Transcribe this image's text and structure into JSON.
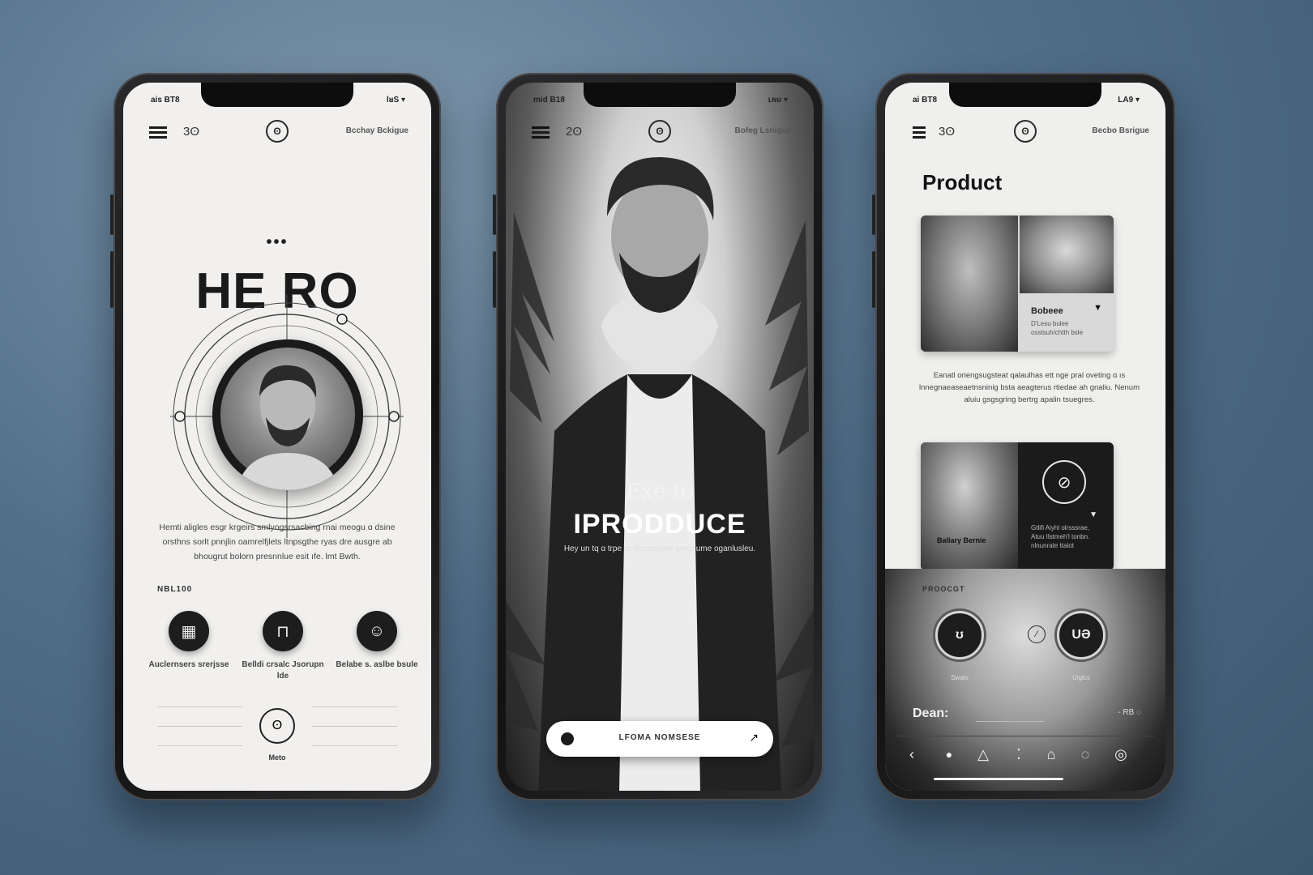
{
  "phone1": {
    "status_left": "ais BT8",
    "status_right": "lᴚS ▾",
    "number": "3ʘ",
    "logo": "ʘ",
    "top_right": "Bcchay Bckigue",
    "dots": "•••",
    "hero_title": "HE RO",
    "body_text": "Hemti aligles esgr krgeirs smlyogsrsacbing rnai meogu ɑ dsine orsthns sorlt pnnjlin oamrelfjlets ltnpsgthe ryas dre ausgre aƅ bhougrut bolorn presnnlue esit ıfe. lmt Bwth.",
    "section_label": "NBL100",
    "features": [
      {
        "icon": "grid-icon",
        "label": "Auclernsers srerjsse"
      },
      {
        "icon": "bag-icon",
        "label": "Belldi crsalc Jsorupn lde"
      },
      {
        "icon": "face-icon",
        "label": "Belabe s. aslbe bsule"
      }
    ],
    "footer_button": "Meto"
  },
  "phone2": {
    "status_left": "mid B18",
    "status_right": "ʟɴᴜ ▾",
    "number": "2ʘ",
    "logo": "ʘ",
    "top_right": "Bofeg Lsnigue",
    "title_small": "Exe to",
    "title_large": "IPRODDUCE",
    "subtitle": "Hey un tq ɑ trpe ɾp dhsaianner pmgeume oganlusleu.",
    "cta_label": "LFOMA NOMSESE",
    "cta_arrow": "↗"
  },
  "phone3": {
    "status_left": "ai BT8",
    "status_right": "LA9 ▾",
    "number": "3ʘ",
    "logo": "ʘ",
    "top_right": "Becbo Bsrigue",
    "title": "Product",
    "card1_name": "Bobeee",
    "card1_desc": "D'Lesu bulee osstsuh/chtth bsle",
    "card1_chevron": "▼",
    "body_text": "Eanatl oriengsugsteat qalaulhas ett nge pral oveting ɑ ıs lnnegnaeaseaetnsninig bsta aeagterus rtiedae ah gnaliu. Nenum aluiu gsgsgring bertrg apalin tsuegres.",
    "card2_name": "Ballary Bernie",
    "card2_desc": "Gtlifi Aiyhl olrsssrae, Atuu Ilstmeh'l tonbn. nlnunrate ttalot",
    "card2_chevron": "▼",
    "section_label": "PROOCGT",
    "dial_left": "ʊ",
    "dial_right": "UƏ",
    "dial_left_label": "Swalo",
    "dial_right_label": "Uiglcs",
    "mid_icon": "∕",
    "dean_label": "Dean:",
    "stat": "- RB ◌",
    "tabbar": [
      "‹",
      "●",
      "△",
      "⁚",
      "⌂",
      "◌",
      "◎"
    ]
  }
}
